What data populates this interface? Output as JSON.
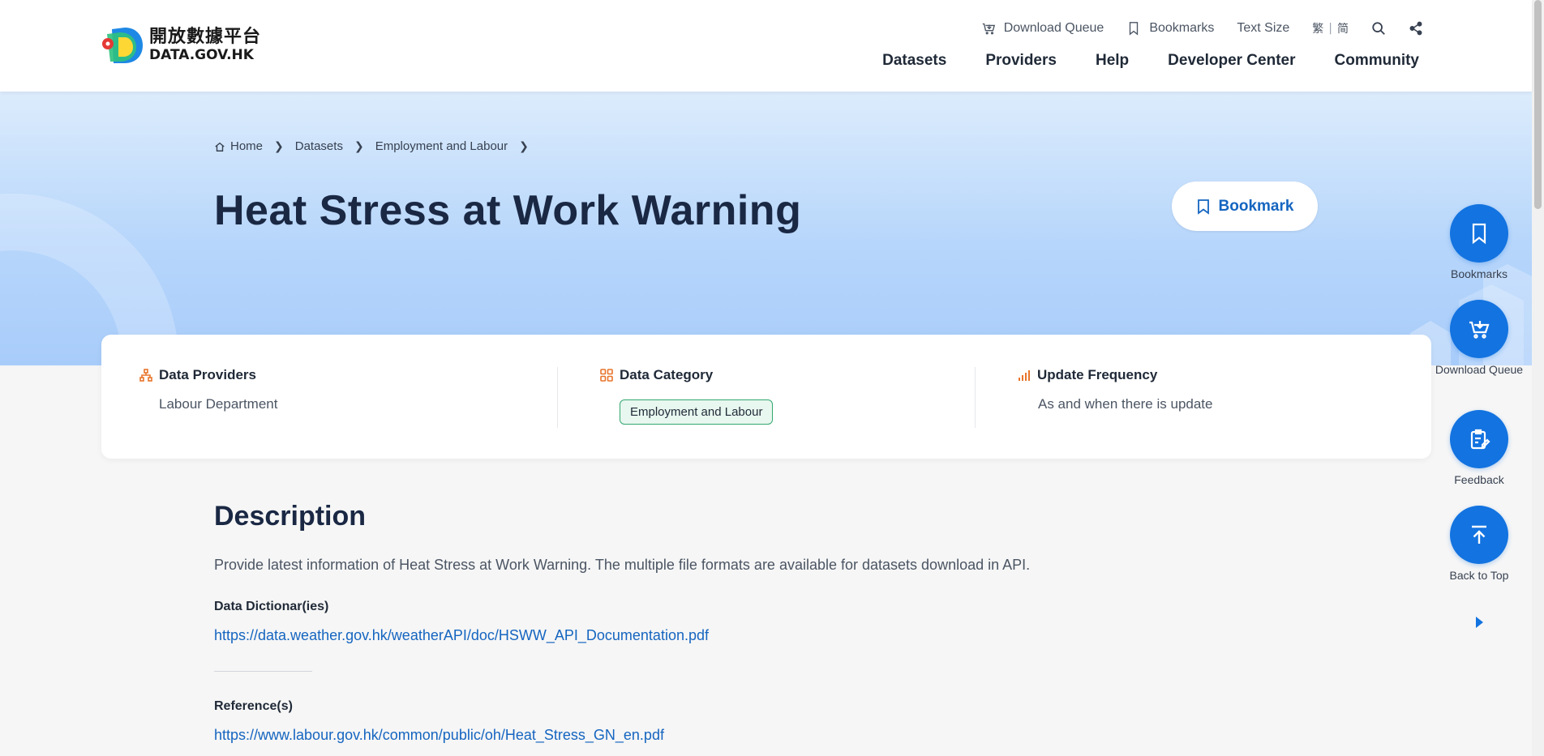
{
  "header": {
    "logo_cn": "開放數據平台",
    "logo_en": "DATA.GOV.HK",
    "util": {
      "download_queue": "Download Queue",
      "bookmarks": "Bookmarks",
      "text_size": "Text Size",
      "lang_trad": "繁",
      "lang_sep": "|",
      "lang_simp": "简"
    },
    "nav": [
      "Datasets",
      "Providers",
      "Help",
      "Developer Center",
      "Community"
    ]
  },
  "breadcrumb": {
    "home": "Home",
    "datasets": "Datasets",
    "category": "Employment and Labour"
  },
  "page": {
    "title": "Heat Stress at Work Warning",
    "bookmark_label": "Bookmark"
  },
  "info": {
    "providers_label": "Data Providers",
    "providers_value": "Labour Department",
    "category_label": "Data Category",
    "category_tag": "Employment and Labour",
    "frequency_label": "Update Frequency",
    "frequency_value": "As and when there is update"
  },
  "description": {
    "title": "Description",
    "text": "Provide latest information of Heat Stress at Work Warning. The multiple file formats are available for datasets download in API.",
    "dictionary_label": "Data Dictionar(ies)",
    "dictionary_link": "https://data.weather.gov.hk/weatherAPI/doc/HSWW_API_Documentation.pdf",
    "reference_label": "Reference(s)",
    "reference_link": "https://www.labour.gov.hk/common/public/oh/Heat_Stress_GN_en.pdf"
  },
  "side": {
    "bookmarks": "Bookmarks",
    "download_queue": "Download Queue",
    "feedback": "Feedback",
    "back_to_top": "Back to Top"
  },
  "colors": {
    "accent": "#1373e0",
    "title": "#1a2844",
    "link": "#1565c0",
    "icon_orange": "#e8742a"
  }
}
